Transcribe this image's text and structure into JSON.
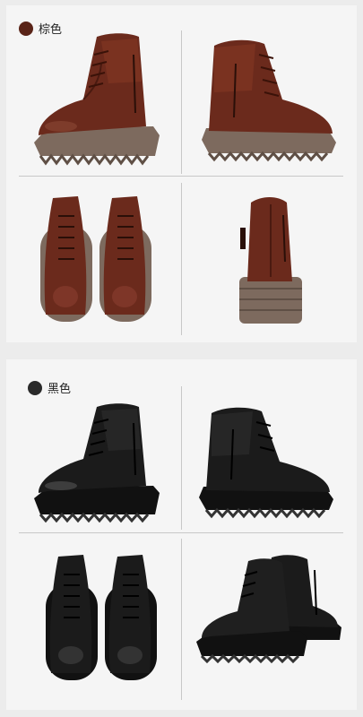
{
  "colors": {
    "brown": "#6b2a1c",
    "brown_sole": "#7d6a5e",
    "black": "#1b1b1b",
    "black_sole": "#111111",
    "panel_bg": "#f5f5f5",
    "page_bg": "#ececec"
  },
  "sections": [
    {
      "label": "棕色",
      "swatch_color": "#5a2418"
    },
    {
      "label": "黑色",
      "swatch_color": "#2a2a2a"
    }
  ]
}
